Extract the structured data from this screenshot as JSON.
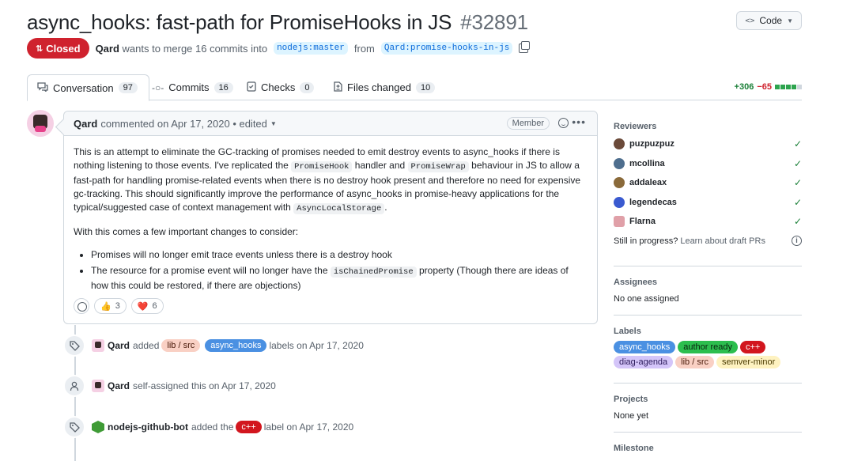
{
  "header": {
    "title": "async_hooks: fast-path for PromiseHooks in JS",
    "number": "#32891",
    "code_button": "Code",
    "state": "Closed",
    "author": "Qard",
    "merge_text": "wants to merge 16 commits into",
    "base_branch": "nodejs:master",
    "from_text": "from",
    "head_branch": "Qard:promise-hooks-in-js"
  },
  "tabs": [
    {
      "label": "Conversation",
      "count": "97"
    },
    {
      "label": "Commits",
      "count": "16"
    },
    {
      "label": "Checks",
      "count": "0"
    },
    {
      "label": "Files changed",
      "count": "10"
    }
  ],
  "diffstat": {
    "additions": "+306",
    "deletions": "−65"
  },
  "comment": {
    "author": "Qard",
    "action": "commented on Apr 17, 2020",
    "edited": "• edited",
    "role": "Member",
    "p1_a": "This is an attempt to eliminate the GC-tracking of promises needed to emit destroy events to async_hooks if there is nothing listening to those events. I've replicated the ",
    "p1_code1": "PromiseHook",
    "p1_b": " handler and ",
    "p1_code2": "PromiseWrap",
    "p1_c": " behaviour in JS to allow a fast-path for handling promise-related events when there is no destroy hook present and therefore no need for expensive gc-tracking. This should significantly improve the performance of async_hooks in promise-heavy applications for the typical/suggested case of context management with ",
    "p1_code3": "AsyncLocalStorage",
    "p1_d": ".",
    "p2": "With this comes a few important changes to consider:",
    "li1": "Promises will no longer emit trace events unless there is a destroy hook",
    "li2_a": "The resource for a promise event will no longer have the ",
    "li2_code": "isChainedPromise",
    "li2_b": " property (Though there are ideas of how this could be restored, if there are objections)",
    "reactions": [
      {
        "emoji": "👍",
        "count": "3"
      },
      {
        "emoji": "❤️",
        "count": "6"
      }
    ]
  },
  "timeline": {
    "event1": {
      "actor": "Qard",
      "verb": "added",
      "labels": [
        "lib / src",
        "async_hooks"
      ],
      "suffix": "labels on Apr 17, 2020"
    },
    "event2": {
      "actor": "Qard",
      "text": "self-assigned this on Apr 17, 2020"
    },
    "event3": {
      "actor": "nodejs-github-bot",
      "verb": "added the",
      "label": "c++",
      "suffix": "label on Apr 17, 2020"
    }
  },
  "sidebar": {
    "reviewers_title": "Reviewers",
    "reviewers": [
      "puzpuzpuz",
      "mcollina",
      "addaleax",
      "legendecas",
      "Flarna"
    ],
    "draft_text": "Still in progress?",
    "draft_link": "Learn about draft PRs",
    "assignees_title": "Assignees",
    "assignees_value": "No one assigned",
    "labels_title": "Labels",
    "labels": [
      "async_hooks",
      "author ready",
      "c++",
      "diag-agenda",
      "lib / src",
      "semver-minor"
    ],
    "projects_title": "Projects",
    "projects_value": "None yet",
    "milestone_title": "Milestone"
  },
  "colors": {
    "closed": "#cf222e",
    "label_async_hooks": "#4a90e2",
    "label_author_ready": "#2cbe4e",
    "label_cpp": "#d2161e",
    "label_diag_agenda": "#d4c5f9",
    "label_lib_src": "#f9d0c4",
    "label_semver_minor": "#fef2c0"
  }
}
